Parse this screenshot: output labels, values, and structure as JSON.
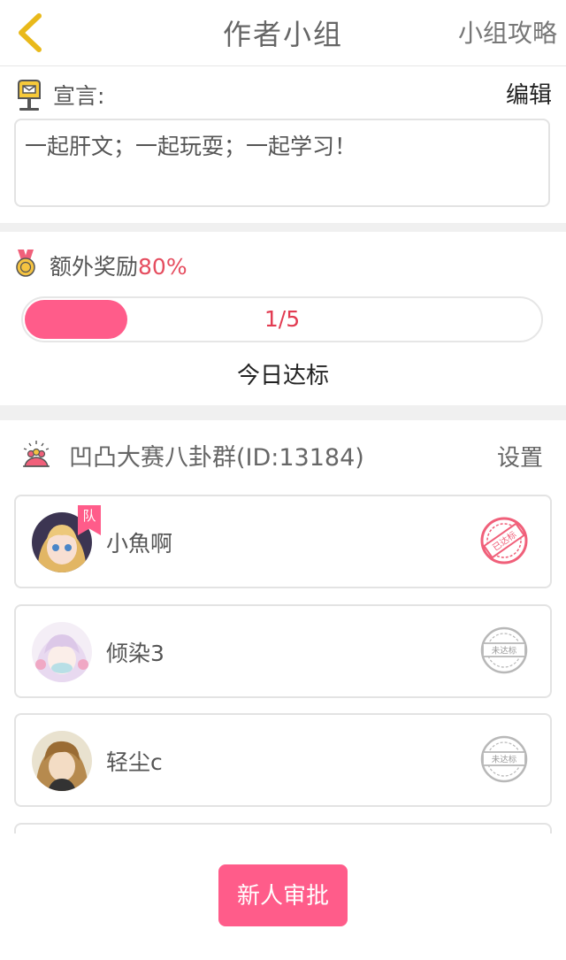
{
  "nav": {
    "title": "作者小组",
    "strategy_label": "小组攻略"
  },
  "manifesto": {
    "label": "宣言:",
    "edit_label": "编辑",
    "text": "一起肝文；一起玩耍；一起学习！"
  },
  "reward": {
    "label": "额外奖励",
    "percent": "80%",
    "progress_text": "1/5",
    "progress_fraction": 0.2,
    "status": "今日达标"
  },
  "group": {
    "name": "凹凸大赛八卦群(ID:13184)",
    "settings_label": "设置"
  },
  "members": [
    {
      "name": "小魚啊",
      "tag": "队",
      "stamp": "已达标"
    },
    {
      "name": "倾染3",
      "stamp": "未达标"
    },
    {
      "name": "轻尘c",
      "stamp": "未达标"
    }
  ],
  "actions": {
    "approve_label": "新人审批"
  },
  "colors": {
    "accent": "#ff5c8a",
    "percent_red": "#e54d5f",
    "gray_stamp": "#b8b8b8"
  }
}
